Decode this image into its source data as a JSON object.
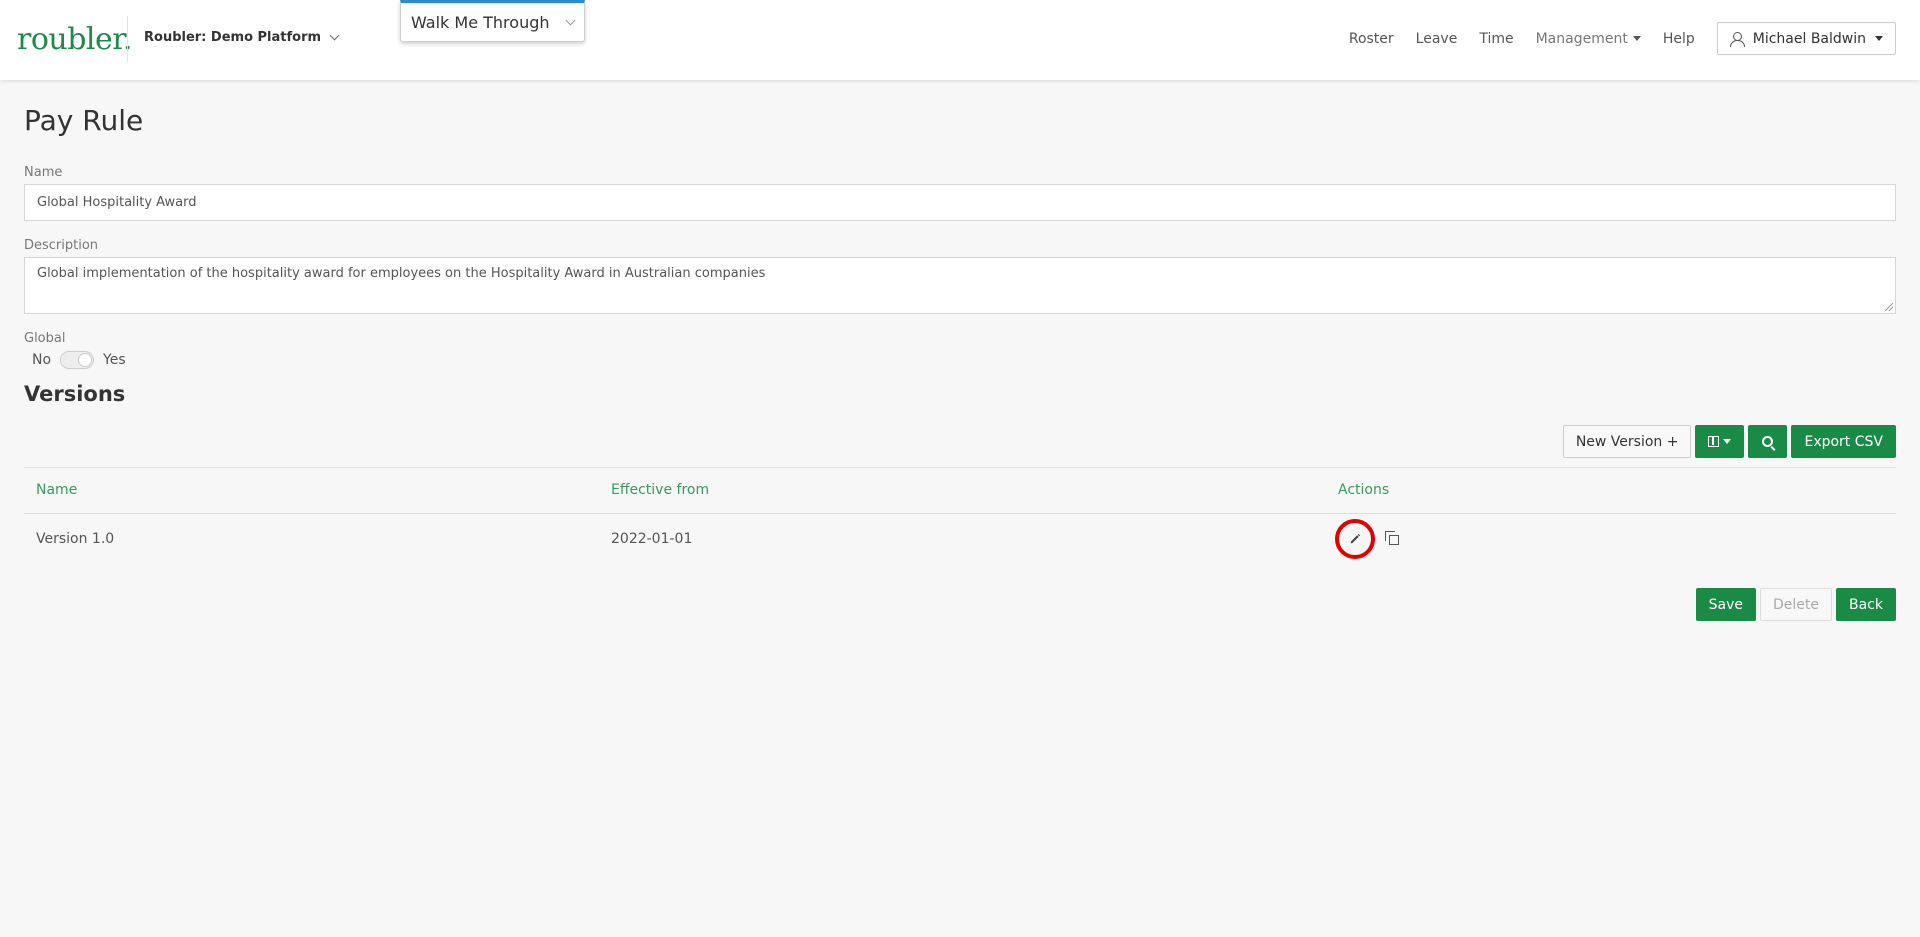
{
  "header": {
    "logo": "roubler.",
    "org": "Roubler: Demo Platform",
    "walk_me": "Walk Me Through",
    "nav": {
      "roster": "Roster",
      "leave": "Leave",
      "time": "Time",
      "management": "Management",
      "help": "Help"
    },
    "user": "Michael Baldwin"
  },
  "page": {
    "title": "Pay Rule",
    "name_label": "Name",
    "name_value": "Global Hospitality Award",
    "description_label": "Description",
    "description_value": "Global implementation of the hospitality award for employees on the Hospitality Award in Australian companies",
    "global_label": "Global",
    "global_no": "No",
    "global_yes": "Yes",
    "global_value": true
  },
  "versions": {
    "title": "Versions",
    "new_version_label": "New Version +",
    "export_label": "Export CSV",
    "columns": [
      "Name",
      "Effective from",
      "Actions"
    ],
    "rows": [
      {
        "name": "Version 1.0",
        "effective_from": "2022-01-01"
      }
    ]
  },
  "footer": {
    "save": "Save",
    "delete": "Delete",
    "back": "Back"
  },
  "colors": {
    "brand_green": "#1a8b47",
    "header_link_green": "#3a9a5c",
    "highlight_red": "#e00000"
  }
}
